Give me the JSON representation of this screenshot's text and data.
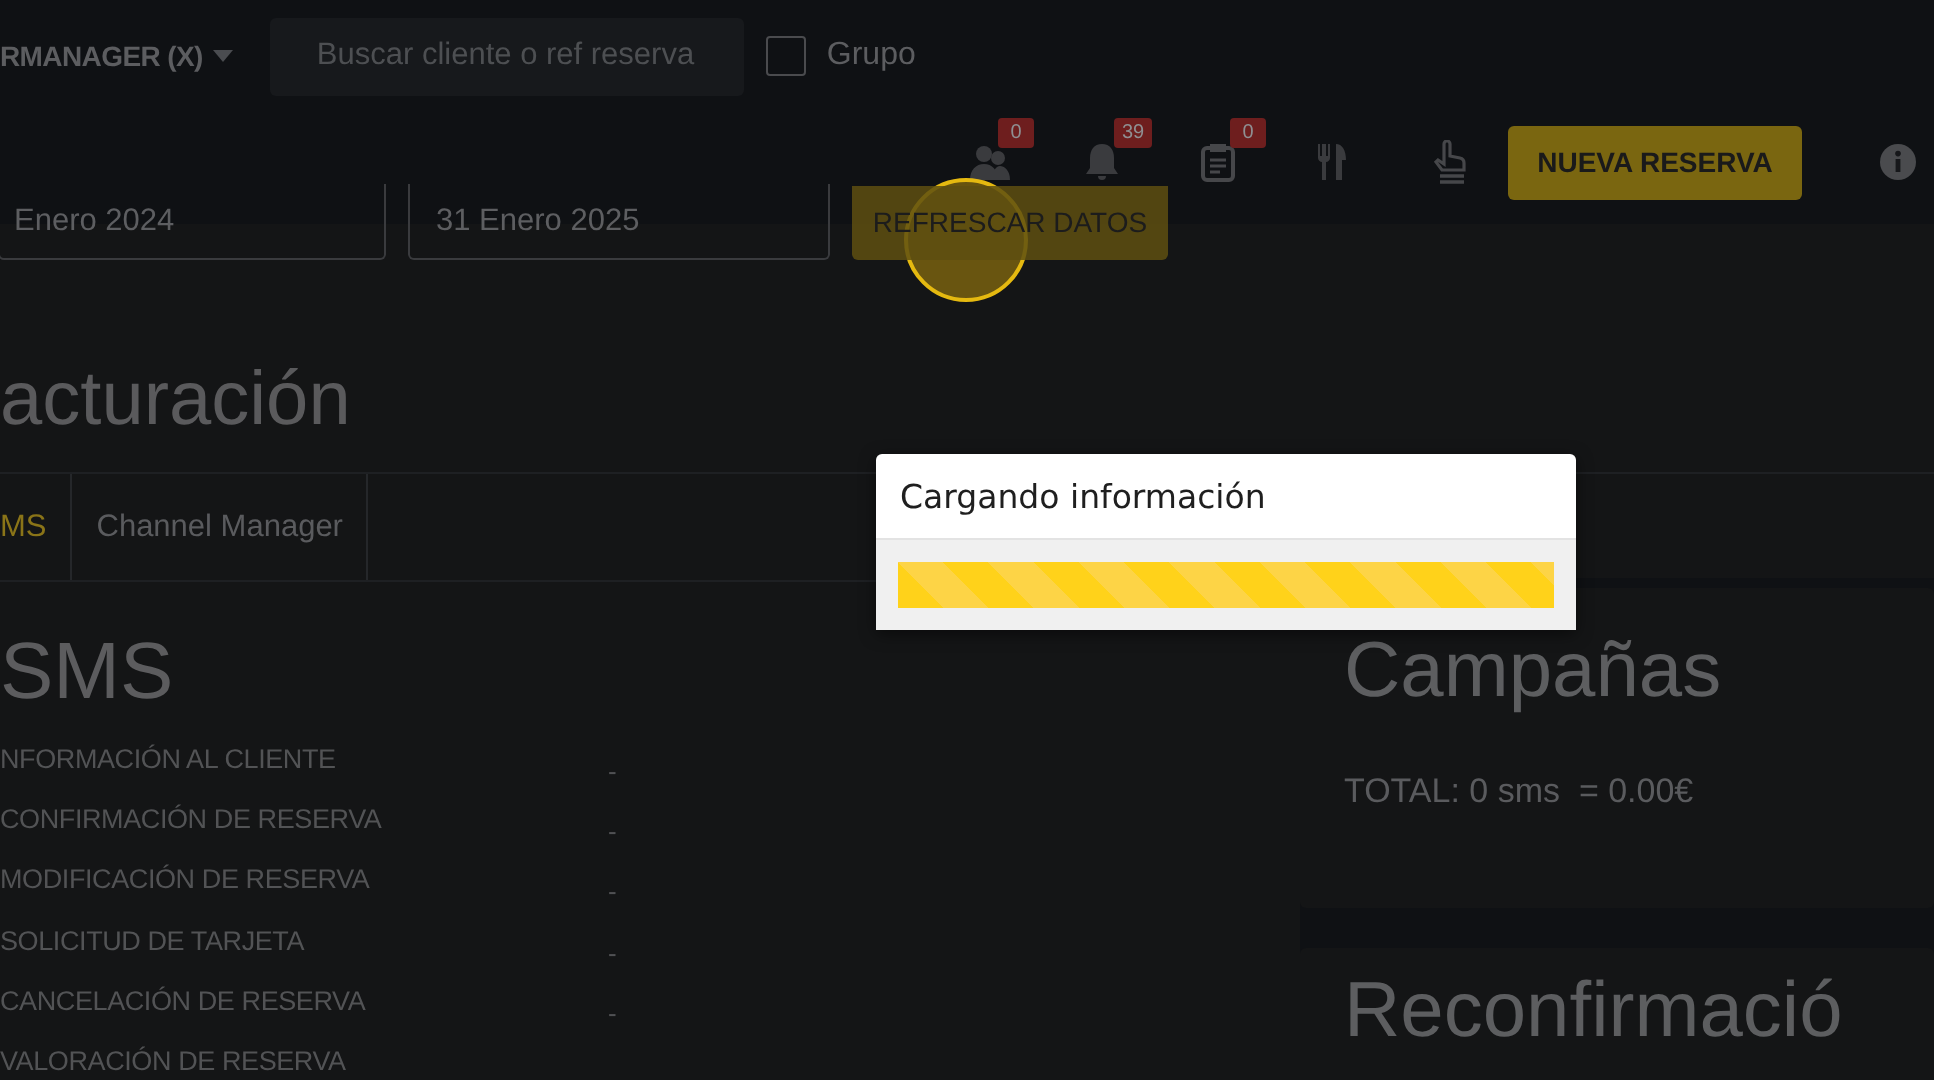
{
  "topbar": {
    "account": "RMANAGER (X)",
    "search": {
      "placeholder": "Buscar cliente o ref reserva"
    },
    "group": {
      "label": "Grupo",
      "checked": false
    }
  },
  "toolbar": {
    "icons": [
      {
        "kind": "users",
        "badge": "0"
      },
      {
        "kind": "bell",
        "badge": "39"
      },
      {
        "kind": "clipboard",
        "badge": "0"
      },
      {
        "kind": "cutlery"
      },
      {
        "kind": "hand"
      }
    ],
    "new_button": "NUEVA RESERVA"
  },
  "filters": {
    "from": "Enero 2024",
    "to": "31 Enero 2025",
    "refresh": "REFRESCAR DATOS"
  },
  "title": "acturación",
  "tabs": [
    {
      "label": "MS",
      "selected": true
    },
    {
      "label": "Channel Manager",
      "selected": false
    }
  ],
  "sms": {
    "title": "SMS",
    "rows": [
      {
        "label": "NFORMACIÓN AL CLIENTE",
        "value": "-"
      },
      {
        "label": "CONFIRMACIÓN DE RESERVA",
        "value": "-"
      },
      {
        "label": "MODIFICACIÓN DE RESERVA",
        "value": "-"
      },
      {
        "label": "SOLICITUD DE TARJETA",
        "value": "-"
      },
      {
        "label": "CANCELACIÓN DE RESERVA",
        "value": "-"
      },
      {
        "label": "VALORACIÓN DE RESERVA"
      }
    ]
  },
  "cards": [
    {
      "title": "Campañas",
      "total": "TOTAL: 0 sms  = 0.00€"
    },
    {
      "title": "Reconfirmació"
    }
  ],
  "modal": {
    "title": "Cargando información",
    "level": 1
  }
}
